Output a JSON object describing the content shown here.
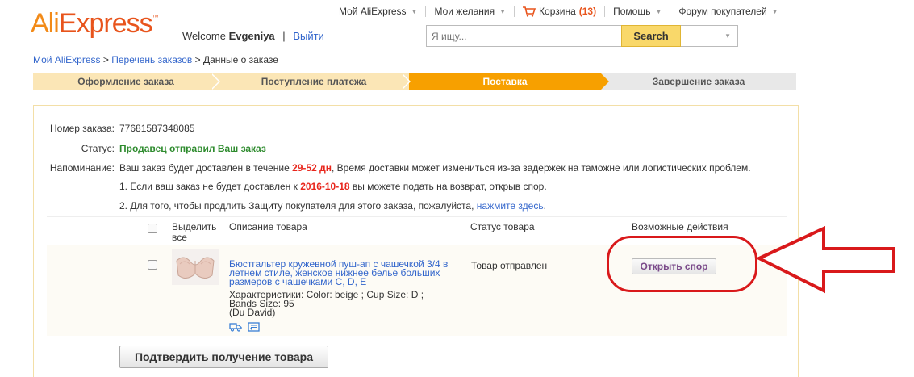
{
  "header": {
    "logo_part1": "Ali",
    "logo_part2": "Express",
    "logo_tm": "™",
    "welcome_text": "Welcome",
    "username": "Evgeniya",
    "separator": "|",
    "logout_label": "Выйти"
  },
  "topnav": {
    "my_aliexpress": "Мой AliExpress",
    "wishlist": "Мои желания",
    "cart": "Корзина",
    "cart_count": "(13)",
    "help": "Помощь",
    "forum": "Форум покупателей"
  },
  "search": {
    "placeholder": "Я ищу...",
    "button_label": "Search"
  },
  "breadcrumb": {
    "item1": "Мой AliExpress",
    "sep1": " > ",
    "item2": "Перечень заказов",
    "sep2": " > ",
    "current": "Данные о заказе"
  },
  "steps": [
    {
      "label": "Оформление заказа",
      "state": "done"
    },
    {
      "label": "Поступление платежа",
      "state": "done"
    },
    {
      "label": "Поставка",
      "state": "active"
    },
    {
      "label": "Завершение заказа",
      "state": "todo"
    }
  ],
  "order": {
    "number_label": "Номер заказа:",
    "number_value": "77681587348085",
    "status_label": "Статус:",
    "status_value": "Продавец отправил Ваш заказ",
    "reminder_label": "Напоминание:",
    "reminder_part1": "Ваш заказ будет доставлен в течение ",
    "reminder_days": "29-52 дн",
    "reminder_part2": ", Время доставки может измениться из-за задержек на таможне или логистических проблем.",
    "note1_part1": "1. Если ваш заказ не будет доставлен к ",
    "note1_date": "2016-10-18",
    "note1_part2": " вы можете подать на возврат, открыв спор.",
    "note2_part1": "2. Для того, чтобы продлить Защиту покупателя для этого заказа, пожалуйста, ",
    "note2_link": "нажмите здесь",
    "note2_end": "."
  },
  "table": {
    "col_select": "Выделить все",
    "col_description": "Описание товара",
    "col_status": "Статус товара",
    "col_actions": "Возможные действия"
  },
  "item": {
    "title": "Бюстгальтер кружевной пуш-ап с чашечкой 3/4 в летнем стиле, женское нижнее белье больших размеров с чашечками C, D, E",
    "props_line1": "Характеристики: Color: beige   ; Cup Size: D   ;",
    "props_line2": "Bands Size: 95",
    "props_line3": "(Du David)",
    "status": "Товар отправлен",
    "action_label": "Открыть спор"
  },
  "confirm_button_label": "Подтвердить получение товара",
  "colors": {
    "brand_orange": "#f7a000",
    "step_done": "#fbe6b6",
    "status_green": "#2e8b2e",
    "highlight_red": "#e8261c",
    "annotation_red": "#d9191b",
    "link_blue": "#3366cc"
  }
}
